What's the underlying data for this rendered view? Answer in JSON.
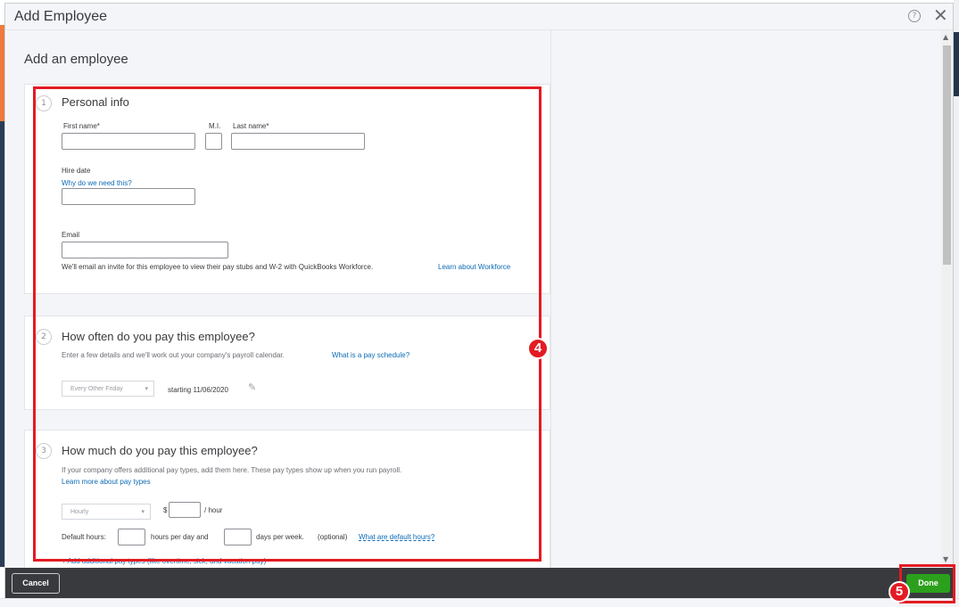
{
  "dialog": {
    "title": "Add Employee",
    "help_icon": "help-circle-icon",
    "close_icon": "close-icon",
    "heading": "Add an employee"
  },
  "personal_info": {
    "step": "1",
    "title": "Personal info",
    "first_name_label": "First name*",
    "mi_label": "M.I.",
    "last_name_label": "Last name*",
    "first_name_value": "",
    "mi_value": "",
    "last_name_value": "",
    "hire_date_label": "Hire date",
    "hire_date_link": "Why do we need this?",
    "hire_date_value": "",
    "email_label": "Email",
    "email_value": "",
    "email_note": "We'll email an invite for this employee to view their pay stubs and W-2 with QuickBooks Workforce.",
    "email_link": "Learn about Workforce"
  },
  "pay_schedule": {
    "step": "2",
    "title": "How often do you pay this employee?",
    "description": "Enter a few details and we'll work out your company's payroll calendar.",
    "link": "What is a pay schedule?",
    "frequency_selected": "Every Other Friday",
    "starting_text": "starting 11/06/2020",
    "edit_icon": "pencil-icon"
  },
  "pay_rate": {
    "step": "3",
    "title": "How much do you pay this employee?",
    "description": "If your company offers additional pay types, add them here. These pay types show up when you run payroll.",
    "link": "Learn more about pay types",
    "pay_type_selected": "Hourly",
    "currency": "$",
    "rate_value": "",
    "rate_unit": "/ hour",
    "default_hours_label": "Default hours:",
    "hours_per_day_value": "",
    "hours_per_day_label": "hours per day and",
    "days_per_week_value": "",
    "days_per_week_label": "days per week.",
    "optional_label": "(optional)",
    "default_hours_link": "What are default hours?",
    "add_pay_types_link": "+ Add additional pay types (like overtime, sick, and vacation pay)"
  },
  "footer": {
    "cancel_label": "Cancel",
    "done_label": "Done"
  },
  "annotations": {
    "badge_4": "4",
    "badge_5": "5",
    "color": "#e31b23"
  },
  "colors": {
    "accent_green": "#2ca01c",
    "link_blue": "#0d6bb5",
    "footer_dark": "#393a3d"
  }
}
